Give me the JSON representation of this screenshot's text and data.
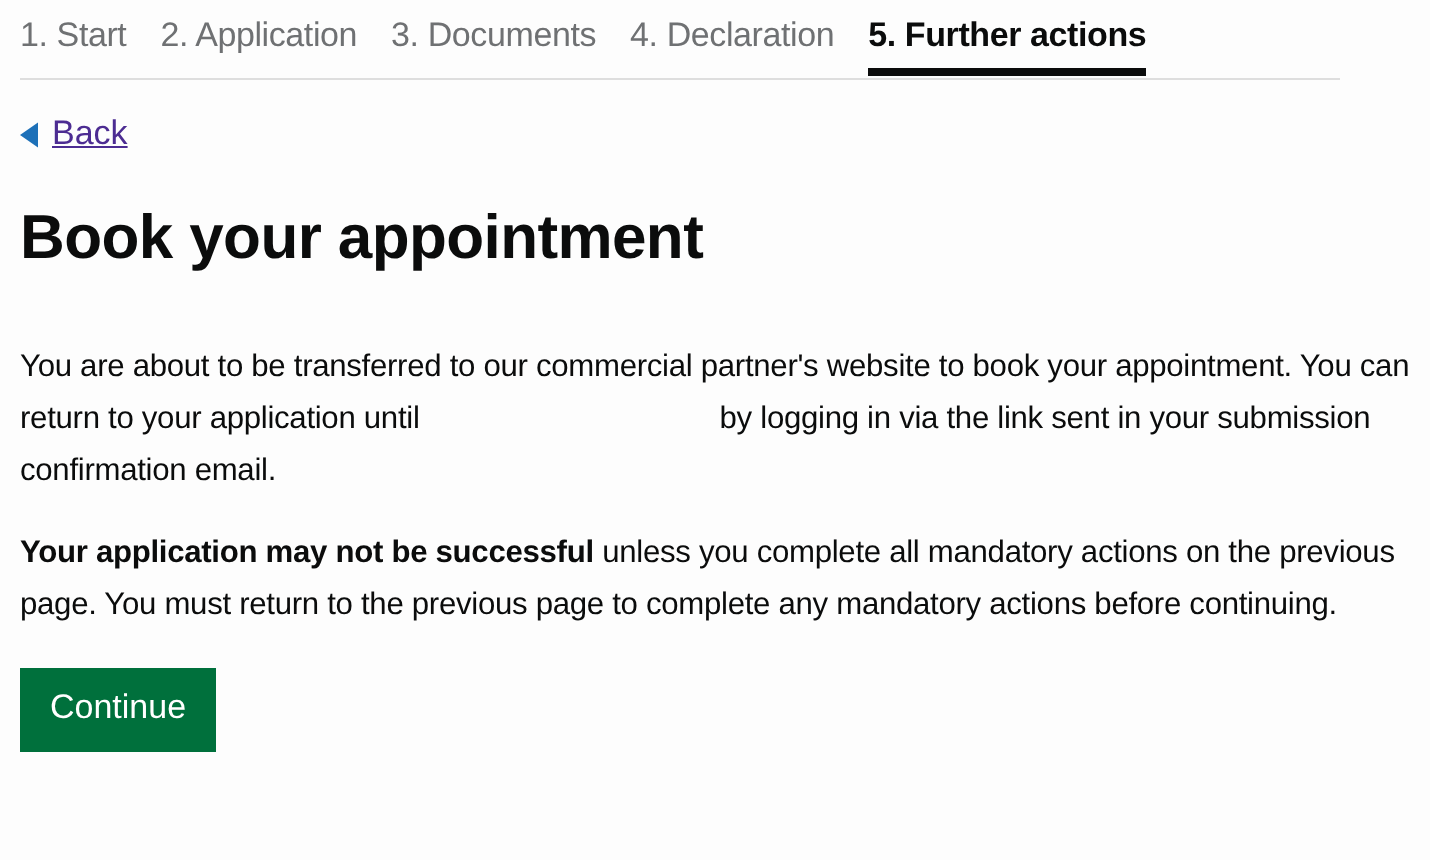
{
  "steps": [
    {
      "label": "1. Start",
      "selected": false
    },
    {
      "label": "2. Application",
      "selected": false
    },
    {
      "label": "3. Documents",
      "selected": false
    },
    {
      "label": "4. Declaration",
      "selected": false
    },
    {
      "label": "5. Further actions",
      "selected": true
    }
  ],
  "back_link": "Back",
  "heading": "Book your appointment",
  "paragraphs": [
    {
      "text_before": "You are about to be transferred to our commercial partner's website to book your appointment. You can return to your application until",
      "text_after": "by logging in via the link sent in your submission confirmation email."
    },
    {
      "text_before": "**Your application may not be successful** unless you complete all mandatory actions on the previous page. You must return to the previous page to complete any mandatory actions before continuing."
    }
  ],
  "continue_button": "Continue"
}
